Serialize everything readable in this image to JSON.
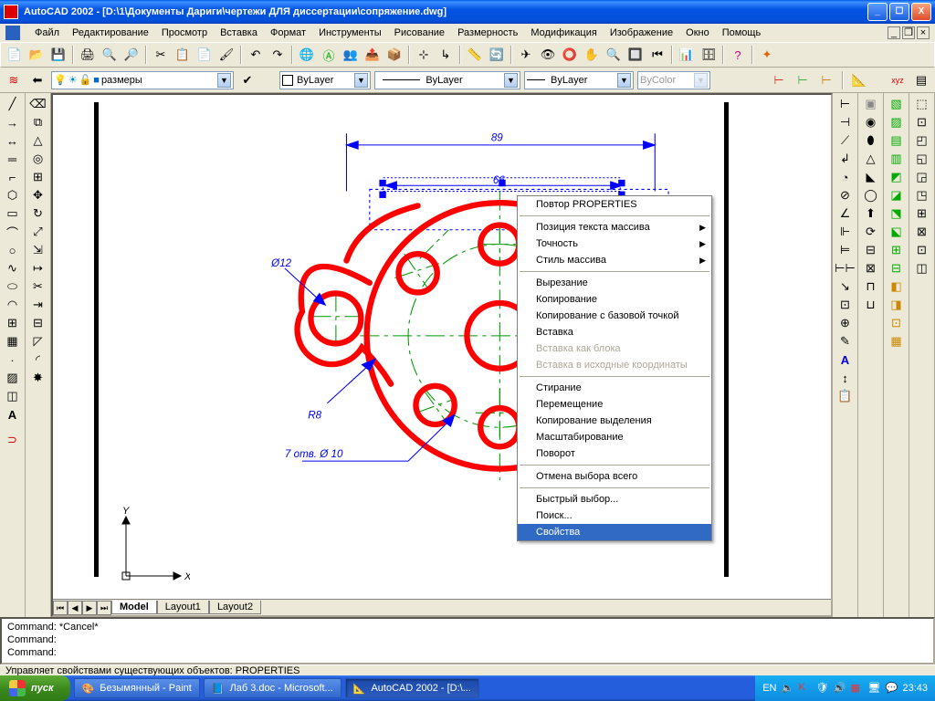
{
  "titlebar": {
    "text": "AutoCAD 2002 - [D:\\1\\Документы Дариги\\чертежи ДЛЯ диссертации\\сопряжение.dwg]"
  },
  "menus": [
    "Файл",
    "Редактирование",
    "Просмотр",
    "Вставка",
    "Формат",
    "Инструменты",
    "Рисование",
    "Размерность",
    "Модификация",
    "Изображение",
    "Окно",
    "Помощь"
  ],
  "props": {
    "layer": "размеры",
    "color": "ByLayer",
    "ltype": "ByLayer",
    "lw": "ByLayer",
    "plot": "ByColor"
  },
  "tabs": {
    "model": "Model",
    "l1": "Layout1",
    "l2": "Layout2"
  },
  "drawing": {
    "dim89": "89",
    "dim66": "66",
    "dimD12": "Ø12",
    "dimR8": "R8",
    "dimHoles": "7 отв. Ø 10",
    "axisX": "X",
    "axisY": "Y"
  },
  "ctx": {
    "repeat": "Повтор PROPERTIES",
    "arraypos": "Позиция текста массива",
    "precision": "Точность",
    "arraystyle": "Стиль массива",
    "cut": "Вырезание",
    "copy": "Копирование",
    "copybase": "Копирование с базовой точкой",
    "paste": "Вставка",
    "pasteblock": "Вставка как блока",
    "pasteorig": "Вставка в исходные координаты",
    "erase": "Стирание",
    "move": "Перемещение",
    "copysel": "Копирование выделения",
    "scale": "Масштабирование",
    "rotate": "Поворот",
    "deselect": "Отмена выбора всего",
    "qselect": "Быстрый выбор...",
    "find": "Поиск...",
    "properties": "Свойства"
  },
  "cmd": {
    "l1": "Command: *Cancel*",
    "l2": "Command:",
    "l3": "Command:"
  },
  "status": "Управляет свойствами существующих объектов: PROPERTIES",
  "taskbar": {
    "start": "пуск",
    "t1": "Безымянный - Paint",
    "t2": "Лаб 3.doc - Microsoft...",
    "t3": "AutoCAD 2002 - [D:\\...",
    "lang": "EN",
    "clock": "23:43"
  }
}
